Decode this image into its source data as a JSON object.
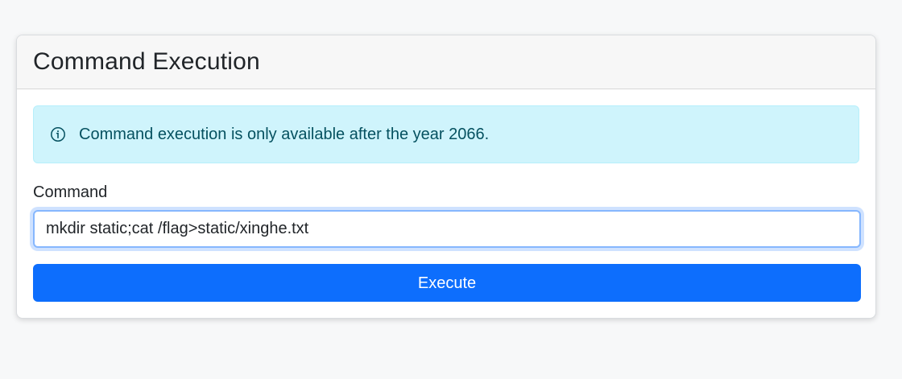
{
  "card": {
    "title": "Command Execution"
  },
  "alert": {
    "icon": "info-icon",
    "message": "Command execution is only available after the year 2066."
  },
  "command_form": {
    "label": "Command",
    "input_value": "mkdir static;cat /flag>static/xinghe.txt",
    "button_label": "Execute"
  },
  "colors": {
    "page_background": "#f7f8f9",
    "alert_background": "#cff4fc",
    "alert_text": "#055160",
    "primary_button": "#0d6efd",
    "focus_border": "#86b7fe"
  }
}
